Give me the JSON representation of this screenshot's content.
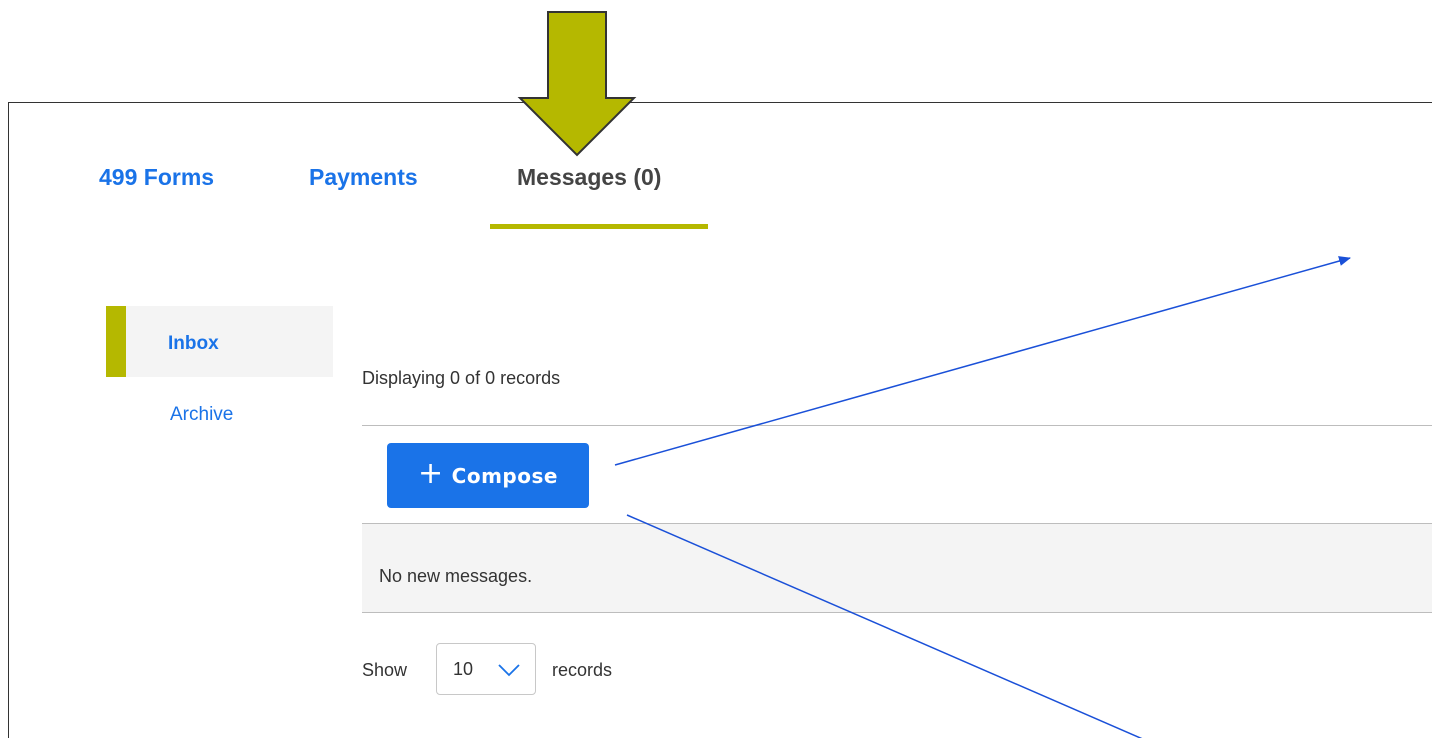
{
  "tabs": [
    {
      "label": "499 Forms",
      "active": false
    },
    {
      "label": "Payments",
      "active": false
    },
    {
      "label": "Messages (0)",
      "active": true
    }
  ],
  "sidebar": {
    "items": [
      {
        "label": "Inbox",
        "active": true
      },
      {
        "label": "Archive",
        "active": false
      }
    ]
  },
  "main": {
    "display_count": "Displaying 0 of 0 records",
    "compose_label": "Compose",
    "empty_message": "No new messages.",
    "pagination": {
      "show_label": "Show",
      "page_size": "10",
      "records_label": "records"
    }
  },
  "colors": {
    "accent": "#b5b800",
    "link": "#1a73e8",
    "button": "#1a73e8",
    "annotation_arrow_fill": "#b5b800",
    "annotation_line": "#1a50d8"
  },
  "icons": {
    "compose": "plus-icon",
    "page_size": "chevron-down-icon"
  }
}
